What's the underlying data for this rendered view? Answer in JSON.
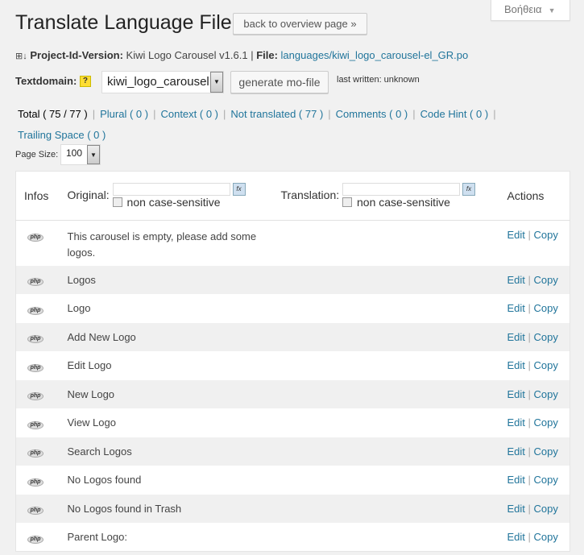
{
  "help_label": "Βοήθεια",
  "title": "Translate Language File",
  "back_button": "back to overview page »",
  "project": {
    "label": "Project-Id-Version:",
    "value": "Kiwi Logo Carousel v1.6.1",
    "file_label": "File:",
    "file": "languages/kiwi_logo_carousel-el_GR.po"
  },
  "textdomain": {
    "label": "Textdomain:",
    "help": "?",
    "value": "kiwi_logo_carousel",
    "generate": "generate mo-file",
    "last_written": "last written:  unknown"
  },
  "filters": [
    {
      "label": "Total ( 75 / 77 )",
      "active": true
    },
    {
      "label": "Plural ( 0 )"
    },
    {
      "label": "Context ( 0 )"
    },
    {
      "label": "Not translated ( 77 )"
    },
    {
      "label": "Comments ( 0 )"
    },
    {
      "label": "Code Hint ( 0 )"
    },
    {
      "label": "Trailing Space ( 0 )"
    }
  ],
  "page_size": {
    "label": "Page Size:",
    "value": "100"
  },
  "table": {
    "headers": {
      "infos": "Infos",
      "original": "Original:",
      "translation": "Translation:",
      "actions": "Actions",
      "case": "non case-sensitive",
      "fx": "fx"
    },
    "icon_label": "php",
    "edit": "Edit",
    "copy": "Copy",
    "rows": [
      "This carousel is empty, please add some logos.",
      "Logos",
      "Logo",
      "Add New Logo",
      "Edit Logo",
      "New Logo",
      "View Logo",
      "Search Logos",
      "No Logos found",
      "No Logos found in Trash",
      "Parent Logo:"
    ]
  }
}
